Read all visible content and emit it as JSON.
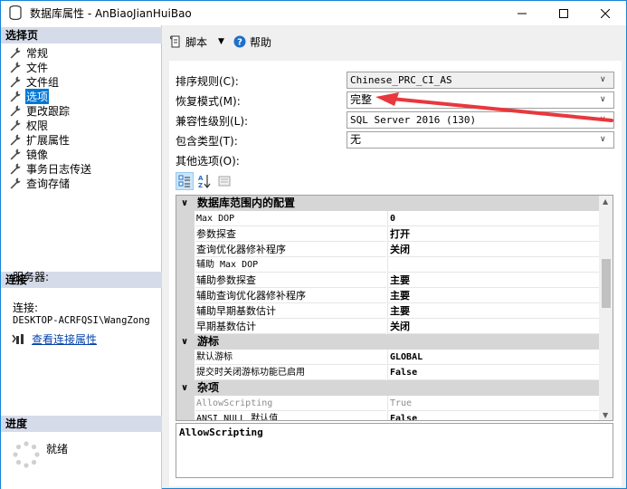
{
  "window": {
    "title": "数据库属性 - AnBiaoJianHuiBao"
  },
  "left_panel": {
    "pages_header": "选择页",
    "pages": [
      {
        "label": "常规",
        "selected": false
      },
      {
        "label": "文件",
        "selected": false
      },
      {
        "label": "文件组",
        "selected": false
      },
      {
        "label": "选项",
        "selected": true
      },
      {
        "label": "更改跟踪",
        "selected": false
      },
      {
        "label": "权限",
        "selected": false
      },
      {
        "label": "扩展属性",
        "selected": false
      },
      {
        "label": "镜像",
        "selected": false
      },
      {
        "label": "事务日志传送",
        "selected": false
      },
      {
        "label": "查询存储",
        "selected": false
      }
    ],
    "connection_header": "连接",
    "server_label": "服务器:",
    "connection_label": "连接:",
    "connection_value": "DESKTOP-ACRFQSI\\WangZong",
    "view_connection_link": "查看连接属性",
    "progress_header": "进度",
    "progress_status": "就绪"
  },
  "toolbar": {
    "script_label": "脚本",
    "help_label": "帮助"
  },
  "form": {
    "collation_label": "排序规则(C):",
    "collation_value": "Chinese_PRC_CI_AS",
    "recovery_label": "恢复模式(M):",
    "recovery_value": "完整",
    "compat_label": "兼容性级别(L):",
    "compat_value": "SQL Server 2016 (130)",
    "containment_label": "包含类型(T):",
    "containment_value": "无",
    "other_options_label": "其他选项(O):"
  },
  "property_grid": {
    "rows": [
      {
        "type": "cat",
        "name": "数据库范围内的配置"
      },
      {
        "type": "prop",
        "name": "Max DOP",
        "value": "0",
        "mono": true
      },
      {
        "type": "prop",
        "name": "参数探查",
        "value": "打开"
      },
      {
        "type": "prop",
        "name": "查询优化器修补程序",
        "value": "关闭"
      },
      {
        "type": "prop",
        "name": "辅助 Max DOP",
        "value": "",
        "mono": true
      },
      {
        "type": "prop",
        "name": "辅助参数探查",
        "value": "主要"
      },
      {
        "type": "prop",
        "name": "辅助查询优化器修补程序",
        "value": "主要"
      },
      {
        "type": "prop",
        "name": "辅助早期基数估计",
        "value": "主要"
      },
      {
        "type": "prop",
        "name": "早期基数估计",
        "value": "关闭"
      },
      {
        "type": "cat",
        "name": "游标"
      },
      {
        "type": "prop",
        "name": "默认游标",
        "value": "GLOBAL",
        "mono": true
      },
      {
        "type": "prop",
        "name": "提交时关闭游标功能已启用",
        "value": "False",
        "mono": true
      },
      {
        "type": "cat",
        "name": "杂项"
      },
      {
        "type": "prop",
        "name": "AllowScripting",
        "value": "True",
        "mono": true,
        "dim": true
      },
      {
        "type": "prop",
        "name": "ANSI NULL 默认值",
        "value": "False",
        "mono": true
      }
    ]
  },
  "description": {
    "text": "AllowScripting"
  },
  "colors": {
    "accent": "#0078d7",
    "section_header": "#d6dbe9",
    "annotation_arrow": "#e8383d"
  }
}
